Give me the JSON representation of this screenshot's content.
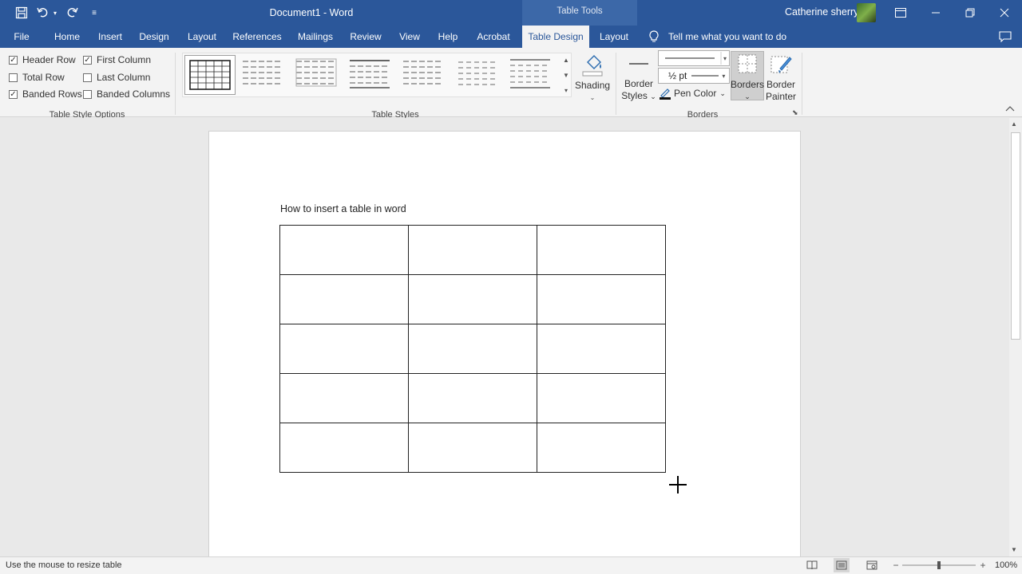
{
  "titlebar": {
    "document_title": "Document1  -  Word",
    "contextual_tab_label": "Table Tools",
    "user_name": "Catherine sherry"
  },
  "menu": {
    "tabs": [
      {
        "label": "File"
      },
      {
        "label": "Home"
      },
      {
        "label": "Insert"
      },
      {
        "label": "Design"
      },
      {
        "label": "Layout"
      },
      {
        "label": "References"
      },
      {
        "label": "Mailings"
      },
      {
        "label": "Review"
      },
      {
        "label": "View"
      },
      {
        "label": "Help"
      },
      {
        "label": "Acrobat"
      },
      {
        "label": "Table Design"
      },
      {
        "label": "Layout"
      }
    ],
    "active_tab": "Table Design",
    "tell_me": "Tell me what you want to do"
  },
  "ribbon": {
    "style_options": {
      "group_label": "Table Style Options",
      "header_row": {
        "label": "Header Row",
        "checked": true
      },
      "first_column": {
        "label": "First Column",
        "checked": true
      },
      "total_row": {
        "label": "Total Row",
        "checked": false
      },
      "last_column": {
        "label": "Last Column",
        "checked": false
      },
      "banded_rows": {
        "label": "Banded Rows",
        "checked": true
      },
      "banded_columns": {
        "label": "Banded Columns",
        "checked": false
      }
    },
    "table_styles": {
      "group_label": "Table Styles",
      "shading_label": "Shading"
    },
    "borders": {
      "group_label": "Borders",
      "border_styles_line1": "Border",
      "border_styles_line2": "Styles",
      "pen_weight": "½ pt",
      "pen_color_label": "Pen Color",
      "borders_label": "Borders",
      "painter_line1": "Border",
      "painter_line2": "Painter"
    }
  },
  "document": {
    "heading": "How to insert a table in word",
    "table": {
      "rows": 5,
      "columns": 3
    }
  },
  "statusbar": {
    "message": "Use the mouse to resize table",
    "zoom": "100%"
  },
  "colors": {
    "accent": "#2b579a",
    "ribbon_bg": "#f3f3f3",
    "canvas_bg": "#e9e9e9"
  }
}
